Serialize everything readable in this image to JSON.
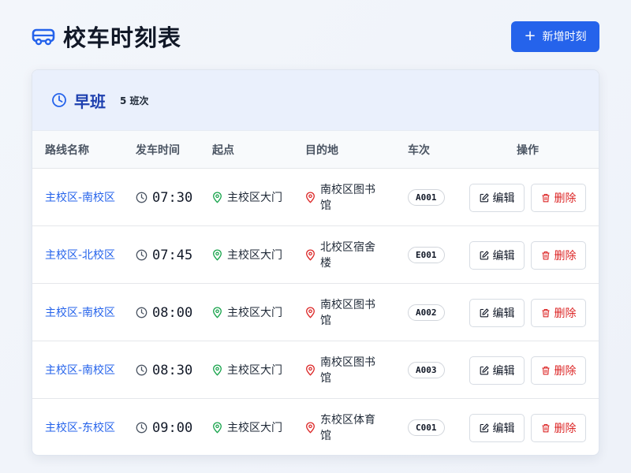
{
  "page": {
    "title": "校车时刻表",
    "add_button_label": "新增时刻"
  },
  "shift": {
    "name": "早班",
    "count": "5 班次"
  },
  "table": {
    "headers": [
      "路线名称",
      "发车时间",
      "起点",
      "目的地",
      "车次",
      "操作"
    ],
    "rows": [
      {
        "route": "主校区-南校区",
        "time": "07:30",
        "start": "主校区大门",
        "dest": "南校区图书馆",
        "code": "A001"
      },
      {
        "route": "主校区-北校区",
        "time": "07:45",
        "start": "主校区大门",
        "dest": "北校区宿舍楼",
        "code": "E001"
      },
      {
        "route": "主校区-南校区",
        "time": "08:00",
        "start": "主校区大门",
        "dest": "南校区图书馆",
        "code": "A002"
      },
      {
        "route": "主校区-南校区",
        "time": "08:30",
        "start": "主校区大门",
        "dest": "南校区图书馆",
        "code": "A003"
      },
      {
        "route": "主校区-东校区",
        "time": "09:00",
        "start": "主校区大门",
        "dest": "东校区体育馆",
        "code": "C001"
      }
    ],
    "edit_label": "编辑",
    "delete_label": "删除"
  },
  "colors": {
    "primary": "#2563eb",
    "danger": "#dc2626",
    "start_pin": "#16a34a",
    "dest_pin": "#dc2626"
  },
  "icons": {
    "header": "bus-icon",
    "shift": "clock-icon",
    "time": "clock-icon",
    "start": "map-pin-icon",
    "dest": "map-pin-icon",
    "edit": "edit-icon",
    "delete": "trash-icon",
    "add": "plus-icon"
  }
}
